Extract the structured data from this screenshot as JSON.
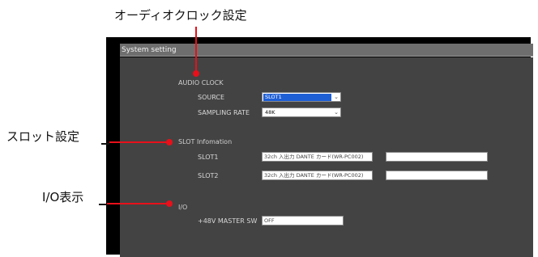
{
  "callouts": {
    "audio_clock": "オーディオクロック設定",
    "slot": "スロット設定",
    "io": "I/O表示"
  },
  "window": {
    "title": "System setting"
  },
  "audio_clock": {
    "header": "AUDIO CLOCK",
    "source_label": "SOURCE",
    "source_value": "SLOT1",
    "sampling_label": "SAMPLING RATE",
    "sampling_value": "48K"
  },
  "slot_info": {
    "header": "SLOT Infomation",
    "slot1_label": "SLOT1",
    "slot1_value": "32ch 入出力 DANTE カード(WR-PC002)",
    "slot1_extra": "",
    "slot2_label": "SLOT2",
    "slot2_value": "32ch 入出力 DANTE カード(WR-PC002)",
    "slot2_extra": ""
  },
  "io": {
    "header": "I/O",
    "phantom_label": "+48V MASTER SW",
    "phantom_value": "OFF"
  },
  "colors": {
    "marker": "#e8101a",
    "panel": "#434343",
    "titlebar": "#6e6e6e",
    "highlight": "#1f5fd6"
  }
}
